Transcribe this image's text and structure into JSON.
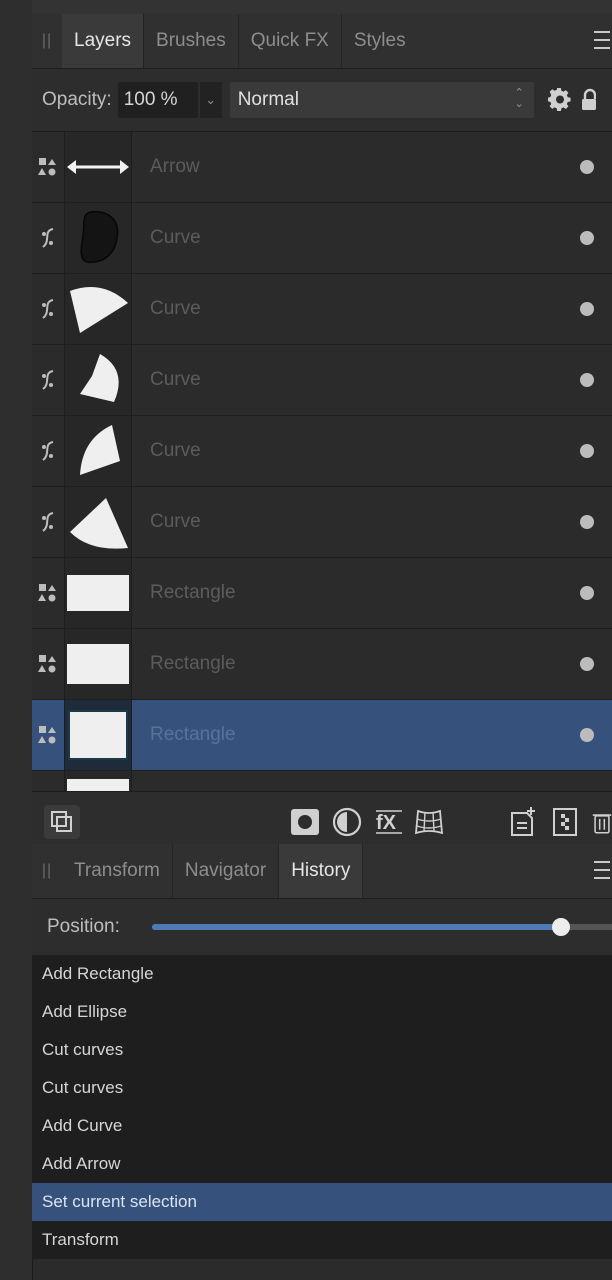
{
  "layers_panel": {
    "tabs": [
      {
        "label": "Layers",
        "active": true
      },
      {
        "label": "Brushes",
        "active": false
      },
      {
        "label": "Quick FX",
        "active": false
      },
      {
        "label": "Styles",
        "active": false
      }
    ],
    "opacity_label": "Opacity:",
    "opacity_value": "100 %",
    "blend_mode": "Normal",
    "layers": [
      {
        "name": "Arrow",
        "type_icon": "shapes-icon",
        "thumb": "arrow",
        "selected": false
      },
      {
        "name": "Curve",
        "type_icon": "curve-icon",
        "thumb": "blob",
        "selected": false
      },
      {
        "name": "Curve",
        "type_icon": "curve-icon",
        "thumb": "wedge-top",
        "selected": false
      },
      {
        "name": "Curve",
        "type_icon": "curve-icon",
        "thumb": "wedge-right",
        "selected": false
      },
      {
        "name": "Curve",
        "type_icon": "curve-icon",
        "thumb": "wedge-mid",
        "selected": false
      },
      {
        "name": "Curve",
        "type_icon": "curve-icon",
        "thumb": "wedge-bottom",
        "selected": false
      },
      {
        "name": "Rectangle",
        "type_icon": "shapes-icon",
        "thumb": "rect",
        "selected": false
      },
      {
        "name": "Rectangle",
        "type_icon": "shapes-icon",
        "thumb": "rect",
        "selected": false
      },
      {
        "name": "Rectangle",
        "type_icon": "shapes-icon",
        "thumb": "rect",
        "selected": true
      }
    ]
  },
  "history_panel": {
    "tabs": [
      {
        "label": "Transform",
        "active": false
      },
      {
        "label": "Navigator",
        "active": false
      },
      {
        "label": "History",
        "active": true
      }
    ],
    "position_label": "Position:",
    "position_fraction": 0.87,
    "items": [
      {
        "label": "Add Rectangle",
        "selected": false
      },
      {
        "label": "Add Ellipse",
        "selected": false
      },
      {
        "label": "Cut curves",
        "selected": false
      },
      {
        "label": "Cut curves",
        "selected": false
      },
      {
        "label": "Add Curve",
        "selected": false
      },
      {
        "label": "Add Arrow",
        "selected": false
      },
      {
        "label": "Set current selection",
        "selected": true
      },
      {
        "label": "Transform",
        "selected": false
      }
    ]
  },
  "colors": {
    "selection": "#36527c",
    "slider_fill": "#4e7ab3"
  }
}
